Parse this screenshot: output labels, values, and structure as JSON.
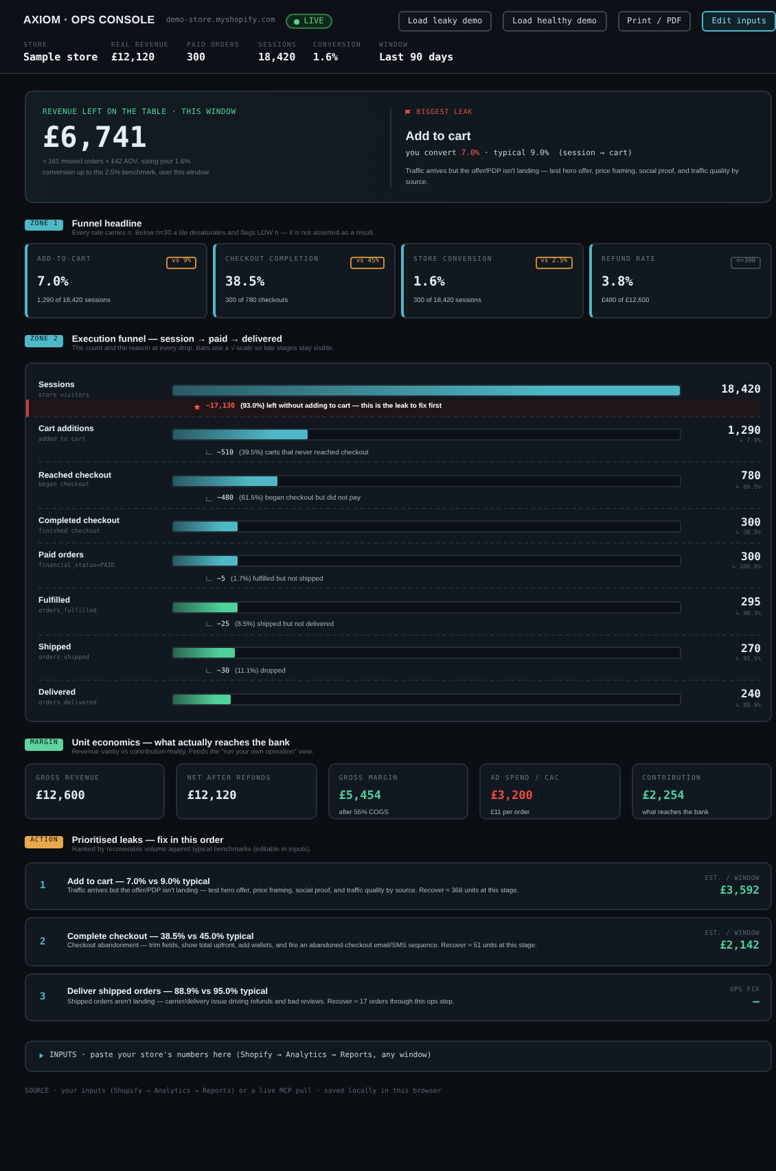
{
  "header": {
    "brand": "AXIOM · OPS CONSOLE",
    "domain": "demo-store.myshopify.com",
    "status": {
      "label": "LIVE",
      "on": true
    },
    "buttons": [
      {
        "label": "Load leaky demo",
        "primary": false
      },
      {
        "label": "Load healthy demo",
        "primary": false
      },
      {
        "label": "Print / PDF",
        "primary": false
      },
      {
        "label": "Edit inputs",
        "primary": true
      }
    ],
    "stats": [
      {
        "label": "STORE",
        "value": "Sample store"
      },
      {
        "label": "REAL REVENUE",
        "value": "£12,120"
      },
      {
        "label": "PAID ORDERS",
        "value": "300"
      },
      {
        "label": "SESSIONS",
        "value": "18,420"
      },
      {
        "label": "CONVERSION",
        "value": "1.6%"
      },
      {
        "label": "WINDOW",
        "value": "Last 90 days"
      }
    ]
  },
  "hero": {
    "label": "REVENUE LEFT ON THE TABLE · THIS WINDOW",
    "amount": "£6,741",
    "note": "≈ 161 missed orders × £42 AOV, sizing your 1.6% conversion up to the 2.5% benchmark, over this window.",
    "leak_label": "BIGGEST LEAK",
    "leak_title": "Add to cart",
    "convert_prefix": "you convert",
    "convert_value": "7.0%",
    "convert_suffix": "· typical 9.0%  (session → cart)",
    "leak_text": "Traffic arrives but the offer/PDP isn't landing — test hero offer, price framing, social proof, and traffic quality by source."
  },
  "zone1": {
    "tag": "ZONE 1",
    "color": "#4fb8c6",
    "title": "Funnel headline",
    "subtitle": "Every rate carries n. Below n=30 a tile desaturates and flags LOW n — it is not asserted as a result.",
    "tiles": [
      {
        "label": "ADD-TO-CART",
        "badge": "vs 9%",
        "warn": true,
        "value": "7.0%",
        "detail": "1,290 of 18,420 sessions"
      },
      {
        "label": "CHECKOUT COMPLETION",
        "badge": "vs 45%",
        "warn": true,
        "value": "38.5%",
        "detail": "300 of 780 checkouts"
      },
      {
        "label": "STORE CONVERSION",
        "badge": "vs 2.5%",
        "warn": true,
        "value": "1.6%",
        "detail": "300 of 18,420 sessions"
      },
      {
        "label": "REFUND RATE",
        "badge": "n=300",
        "warn": false,
        "value": "3.8%",
        "detail": "£480 of £12,600"
      }
    ]
  },
  "zone2": {
    "tag": "ZONE 2",
    "color": "#4fb8c6",
    "title": "Execution funnel — session → paid → delivered",
    "subtitle": "The count and the reason at every drop. Bars use a √-scale so late stages stay visible.",
    "stages": [
      {
        "name": "Sessions",
        "field": "store visitors",
        "count": "18,420",
        "level": 1.0,
        "color": "#4fb8c6",
        "drop": {
          "amount": "−17,130",
          "reason": "(93.0%) left without adding to cart — this is the leak to fix first",
          "highlight": true
        }
      },
      {
        "name": "Cart additions",
        "field": "added to cart",
        "count": "1,290",
        "rate": "↳ 7.0%",
        "level": 0.265,
        "color": "#4fb8c6",
        "drop": {
          "amount": "−510",
          "reason": "(39.5%) carts that never reached checkout",
          "highlight": false
        }
      },
      {
        "name": "Reached checkout",
        "field": "began checkout",
        "count": "780",
        "rate": "↳ 60.5%",
        "level": 0.207,
        "color": "#4fb8c6",
        "drop": {
          "amount": "−480",
          "reason": "(61.5%) began checkout but did not pay",
          "highlight": false
        }
      },
      {
        "name": "Completed checkout",
        "field": "finished checkout",
        "count": "300",
        "rate": "↳ 38.5%",
        "level": 0.127,
        "color": "#4fb8c6"
      },
      {
        "name": "Paid orders",
        "field": "financial_status=PAID",
        "count": "300",
        "rate": "↳ 100.0%",
        "level": 0.127,
        "color": "#4fb8c6",
        "drop": {
          "amount": "−5",
          "reason": "(1.7%) fulfilled but not shipped",
          "highlight": false
        }
      },
      {
        "name": "Fulfilled",
        "field": "orders_fulfilled",
        "count": "295",
        "rate": "↳ 98.3%",
        "level": 0.127,
        "color": "#4fd19a",
        "drop": {
          "amount": "−25",
          "reason": "(8.5%) shipped but not delivered",
          "highlight": false
        }
      },
      {
        "name": "Shipped",
        "field": "orders_shipped",
        "count": "270",
        "rate": "↳ 91.5%",
        "level": 0.121,
        "color": "#4fd19a",
        "drop": {
          "amount": "−30",
          "reason": "(11.1%) dropped",
          "highlight": false
        }
      },
      {
        "name": "Delivered",
        "field": "orders_delivered",
        "count": "240",
        "rate": "↳ 88.9%",
        "level": 0.113,
        "color": "#4fd19a"
      }
    ]
  },
  "margin": {
    "tag": "MARGIN",
    "color": "#5fd3a0",
    "title": "Unit economics — what actually reaches the bank",
    "subtitle": "Revenue vanity vs contribution reality. Feeds the \"run your own operation\" view.",
    "tiles": [
      {
        "label": "GROSS REVENUE",
        "value": "£12,600",
        "kind": "plain"
      },
      {
        "label": "NET AFTER REFUNDS",
        "value": "£12,120",
        "kind": "plain"
      },
      {
        "label": "GROSS MARGIN",
        "value": "£5,454",
        "kind": "good",
        "detail": "after 55% COGS"
      },
      {
        "label": "AD SPEND / CAC",
        "value": "£3,200",
        "kind": "bad",
        "detail": "£11 per order"
      },
      {
        "label": "CONTRIBUTION",
        "value": "£2,254",
        "kind": "good",
        "detail": "what reaches the bank"
      }
    ]
  },
  "action": {
    "tag": "ACTION",
    "color": "#e8a94a",
    "title": "Prioritised leaks — fix in this order",
    "subtitle": "Ranked by recoverable volume against typical benchmarks (editable in inputs).",
    "leaks": [
      {
        "rank": "1",
        "title": "Add to cart — 7.0% vs 9.0% typical",
        "text": "Traffic arrives but the offer/PDP isn't landing — test hero offer, price framing, social proof, and traffic quality by source. Recover ≈ 368 units at this stage.",
        "metric_label": "EST. / WINDOW",
        "metric": "£3,592"
      },
      {
        "rank": "2",
        "title": "Complete checkout — 38.5% vs 45.0% typical",
        "text": "Checkout abandonment — trim fields, show total upfront, add wallets, and fire an abandoned-checkout email/SMS sequence. Recover ≈ 51 units at this stage.",
        "metric_label": "EST. / WINDOW",
        "metric": "£2,142"
      },
      {
        "rank": "3",
        "title": "Deliver shipped orders — 88.9% vs 95.0% typical",
        "text": "Shipped orders aren't landing — carrier/delivery issue driving refunds and bad reviews. Recover ≈ 17 orders through this ops step.",
        "metric_label": "OPS FIX",
        "metric": "—"
      }
    ]
  },
  "inputs": {
    "label": "INPUTS · paste your store's numbers here (Shopify → Analytics → Reports, any window)",
    "expanded": false
  },
  "footer": "SOURCE · your inputs (Shopify → Analytics → Reports) or a live MCP pull · saved locally in this browser"
}
